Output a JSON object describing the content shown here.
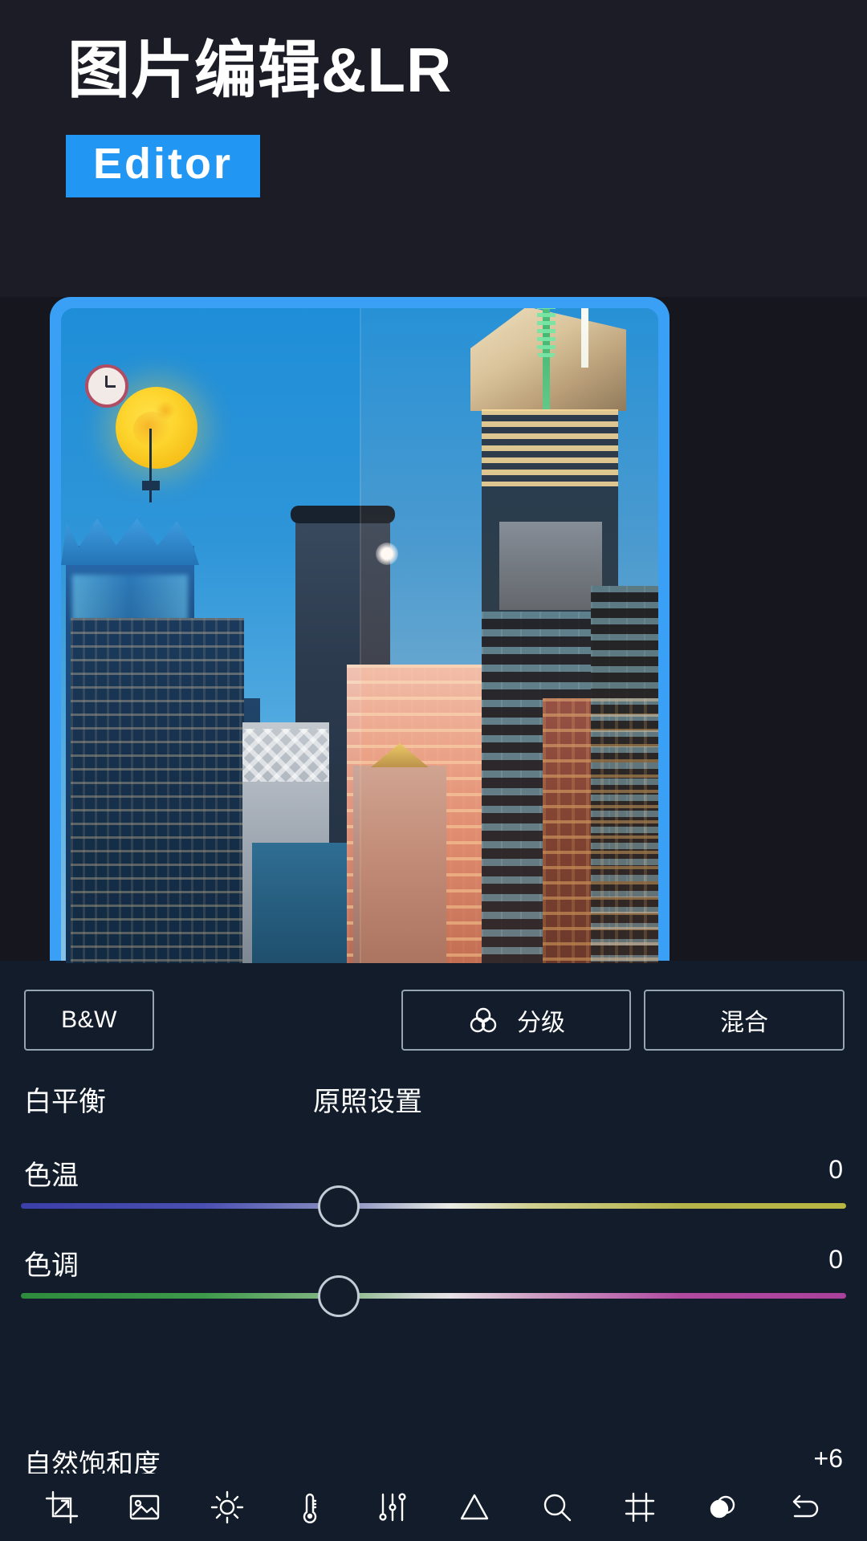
{
  "hero": {
    "title": "图片编辑&LR",
    "badge_label": "Editor",
    "badge_color": "#2196f3",
    "background_color": "#1c1c26"
  },
  "preview": {
    "frame_color": "#3aa0f5",
    "description": "城市夜景照片预览（左右对比分割）"
  },
  "panel": {
    "background_color": "#121c2b",
    "mode_buttons": [
      {
        "id": "bw",
        "label": "B&W",
        "icon": null
      },
      {
        "id": "grade",
        "label": "分级",
        "icon": "color-grading-icon"
      },
      {
        "id": "blend",
        "label": "混合",
        "icon": null
      }
    ],
    "white_balance": {
      "label": "白平衡",
      "value": "原照设置"
    },
    "sliders": [
      {
        "id": "temperature",
        "label": "色温",
        "value": "0",
        "position_pct": 50,
        "gradient": "blue-to-yellow"
      },
      {
        "id": "tint",
        "label": "色调",
        "value": "0",
        "position_pct": 50,
        "gradient": "green-to-magenta"
      }
    ],
    "vibrance": {
      "label": "自然饱和度",
      "value": "+6"
    }
  },
  "toolbar": {
    "items": [
      {
        "id": "crop",
        "icon": "crop-icon"
      },
      {
        "id": "presets",
        "icon": "image-icon"
      },
      {
        "id": "light",
        "icon": "brightness-sun-icon"
      },
      {
        "id": "color",
        "icon": "thermometer-icon"
      },
      {
        "id": "effects",
        "icon": "sliders-icon"
      },
      {
        "id": "detail-geometry",
        "icon": "triangle-icon"
      },
      {
        "id": "detail",
        "icon": "magnifier-icon"
      },
      {
        "id": "geometry",
        "icon": "grid-frame-icon"
      },
      {
        "id": "masking",
        "icon": "two-circles-icon"
      },
      {
        "id": "undo",
        "icon": "undo-arrow-icon"
      }
    ]
  }
}
